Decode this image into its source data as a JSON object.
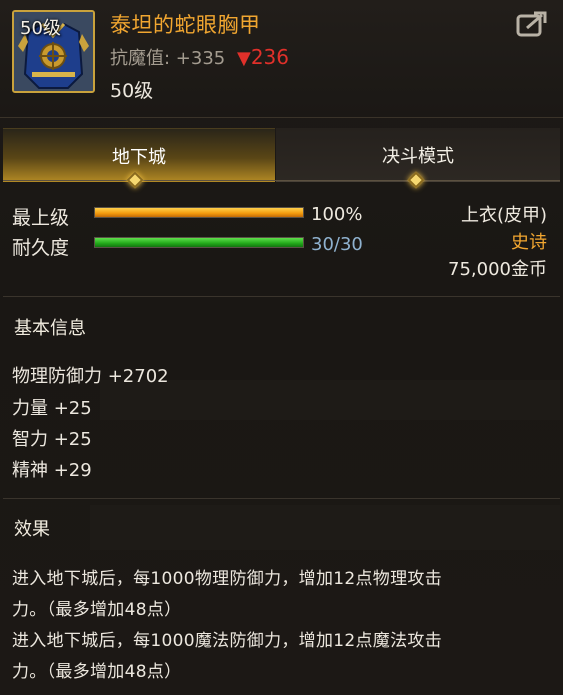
{
  "item": {
    "level_badge": "50级",
    "name": "泰坦的蛇眼胸甲",
    "resist_label": "抗魔值: +335",
    "resist_down_arrow": "▼",
    "resist_down_value": "236",
    "required_level": "50级"
  },
  "tabs": [
    {
      "label": "地下城",
      "active": true
    },
    {
      "label": "决斗模式",
      "active": false
    }
  ],
  "stats": {
    "upgrade_label": "最上级",
    "upgrade_value": "100%",
    "upgrade_fraction": 1.0,
    "durability_label": "耐久度",
    "durability_value": "30/30",
    "durability_fraction": 1.0
  },
  "info": {
    "slot": "上衣(皮甲)",
    "rarity": "史诗",
    "price": "75,000金币"
  },
  "basic": {
    "title": "基本信息",
    "attrs": [
      "物理防御力 +2702",
      "力量 +25",
      "智力 +25",
      "精神 +29"
    ]
  },
  "effect": {
    "title": "效果",
    "lines": [
      "进入地下城后，每1000物理防御力，增加12点物理攻击",
      "力。（最多增加48点）",
      "进入地下城后，每1000魔法防御力，增加12点魔法攻击",
      "力。（最多增加48点）"
    ]
  },
  "icons": {
    "share": "share-icon",
    "item": "chest-armor-icon"
  },
  "colors": {
    "item_name": "#f1a630",
    "rarity": "#f1a630",
    "down": "#e0302a",
    "durability_text": "#8fb2cf"
  }
}
